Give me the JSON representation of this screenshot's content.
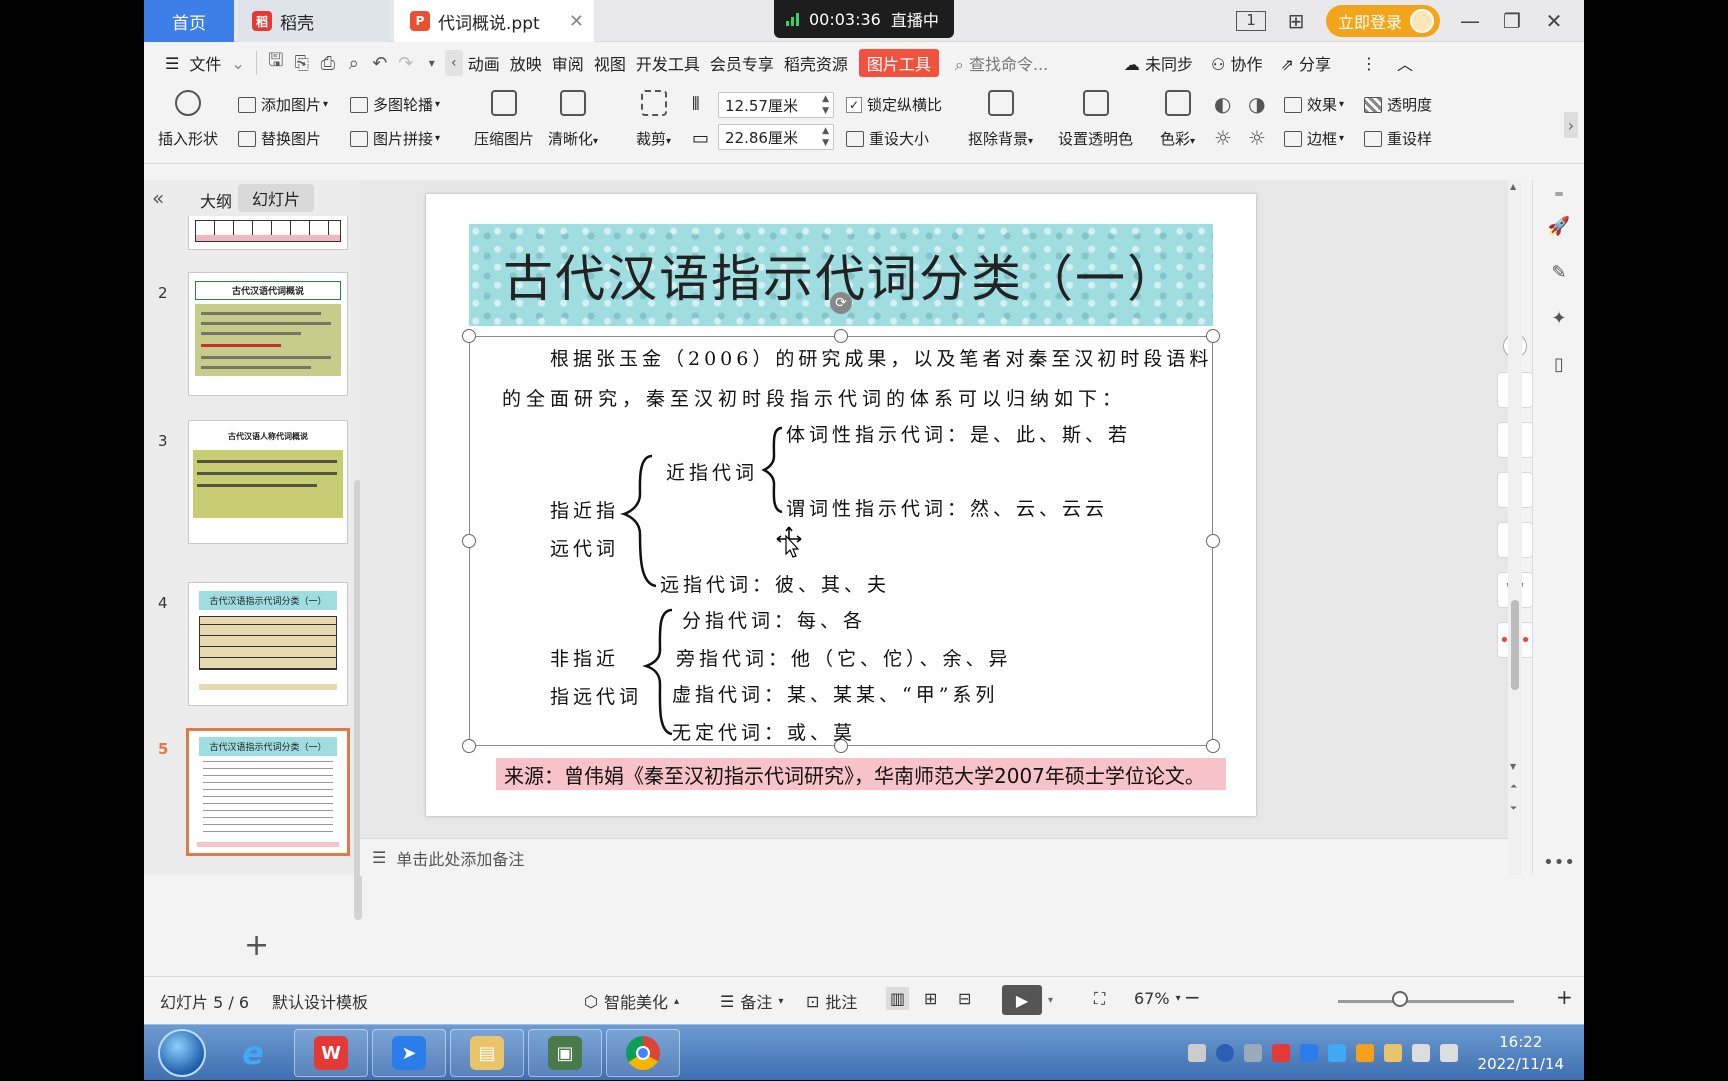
{
  "tabs": {
    "home": "首页",
    "daoke": "稻壳",
    "doc": "代词概说.ppt"
  },
  "live": {
    "time": "00:03:36",
    "label": "直播中"
  },
  "login": {
    "label": "立即登录"
  },
  "menu": {
    "file": "文件",
    "items": [
      "动画",
      "放映",
      "审阅",
      "视图",
      "开发工具",
      "会员专享",
      "稻壳资源"
    ],
    "picture_tools": "图片工具",
    "search_placeholder": "查找命令...",
    "unsynced": "未同步",
    "collaborate": "协作",
    "share": "分享"
  },
  "ribbon": {
    "insert_shape": "插入形状",
    "add_picture": "添加图片",
    "replace_picture": "替换图片",
    "multi_carousel": "多图轮播",
    "picture_stitch": "图片拼接",
    "compress": "压缩图片",
    "sharpen": "清晰化",
    "crop": "裁剪",
    "width": "12.57厘米",
    "height": "22.86厘米",
    "lock_ratio": "锁定纵横比",
    "reset_size": "重设大小",
    "remove_bg": "抠除背景",
    "set_transparent": "设置透明色",
    "color": "色彩",
    "effects": "效果",
    "transparency": "透明度",
    "border": "边框",
    "reset": "重设样"
  },
  "panel": {
    "outline_tab": "大纲",
    "slides_tab": "幻灯片",
    "thumbnails": [
      {
        "num": "2",
        "title": "古代汉语代词概说"
      },
      {
        "num": "3",
        "title": "古代汉语人称代词概说"
      },
      {
        "num": "4",
        "title": "古代汉语指示代词分类（一）"
      },
      {
        "num": "5",
        "title": "古代汉语指示代词分类（一）"
      }
    ]
  },
  "slide": {
    "title": "古代汉语指示代词分类（一）",
    "intro_line1": "根据张玉金（2006）的研究成果，以及笔者对秦至汉初时段语料",
    "intro_line2": "的全面研究，秦至汉初时段指示代词的体系可以归纳如下：",
    "group1_line1": "指近指",
    "group1_line2": "远代词",
    "near": "近指代词",
    "nominal": "体词性指示代词：是、此、斯、若",
    "predicative": "谓词性指示代词：然、云、云云",
    "far": "远指代词：彼、其、夫",
    "group2_line1": "非指近",
    "group2_line2": "指远代词",
    "distributive": "分指代词：每、各",
    "other": "旁指代词：他（它、佗）、余、异",
    "virtual": "虚指代词：某、某某、“甲”系列",
    "indefinite": "无定代词：或、莫",
    "source": "来源：曾伟娟《秦至汉初指示代词研究》，华南师范大学2007年硕士学位论文。"
  },
  "notes": {
    "placeholder": "单击此处添加备注"
  },
  "status": {
    "slide_count": "幻灯片 5 / 6",
    "template": "默认设计模板",
    "beautify": "智能美化",
    "notes": "备注",
    "comment": "批注",
    "zoom": "67%"
  },
  "taskbar": {
    "time": "16:22",
    "date": "2022/11/14"
  },
  "colors": {
    "accent_blue": "#3d7ee8",
    "picture_tools_red": "#f1523d",
    "selected_thumb": "#e07a49",
    "title_band": "#9fdde0",
    "source_bg": "#f7c3c8",
    "login_orange": "#f2a51a"
  }
}
